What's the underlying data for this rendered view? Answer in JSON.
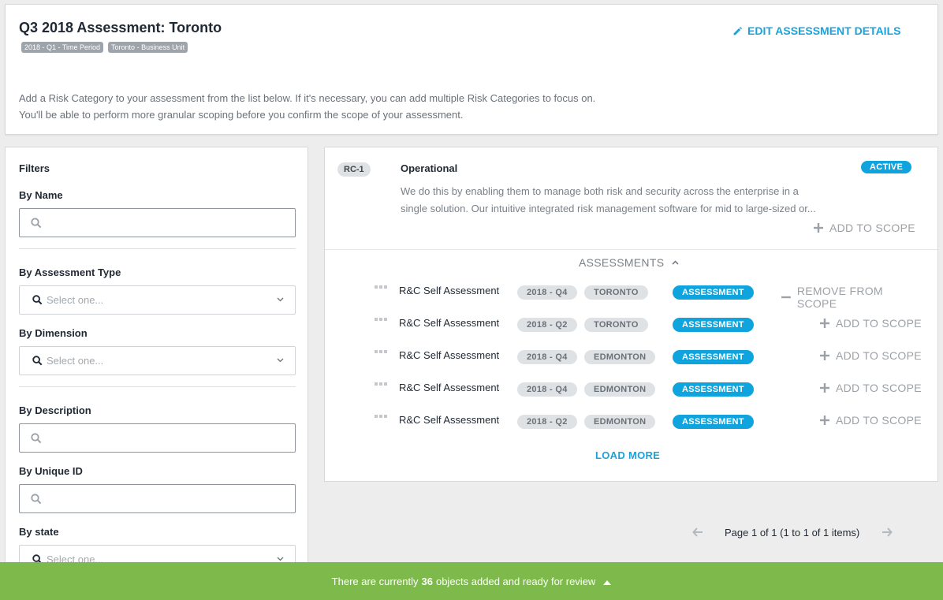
{
  "header": {
    "title": "Q3 2018 Assessment: Toronto",
    "tags": [
      "2018 - Q1 - Time Period",
      "Toronto - Business Unit"
    ],
    "edit_label": "EDIT ASSESSMENT DETAILS",
    "intro_line1": "Add a Risk Category to your assessment from the list below. If it's necessary, you can add multiple Risk Categories to focus on.",
    "intro_line2": "You'll be able to perform more granular scoping before you confirm the scope of your assessment."
  },
  "filters": {
    "title": "Filters",
    "by_name": "By Name",
    "by_assessment_type": "By Assessment Type",
    "by_dimension": "By Dimension",
    "by_description": "By Description",
    "by_unique_id": "By Unique ID",
    "by_state": "By state",
    "select_placeholder": "Select one..."
  },
  "category": {
    "id": "RC-1",
    "name": "Operational",
    "status": "ACTIVE",
    "description_line1": "We do this by enabling them to manage both risk and security across the enterprise in a",
    "description_line2": "single solution. Our intuitive integrated risk management software for mid to large-sized or...",
    "add_to_scope": "ADD TO SCOPE",
    "assessments_label": "ASSESSMENTS",
    "load_more": "LOAD MORE"
  },
  "assessments": [
    {
      "name": "R&C Self Assessment",
      "period": "2018 - Q4",
      "unit": "TORONTO",
      "type": "ASSESSMENT",
      "action": "REMOVE FROM SCOPE"
    },
    {
      "name": "R&C Self Assessment",
      "period": "2018 - Q2",
      "unit": "TORONTO",
      "type": "ASSESSMENT",
      "action": "ADD TO SCOPE"
    },
    {
      "name": "R&C Self Assessment",
      "period": "2018 - Q4",
      "unit": "EDMONTON",
      "type": "ASSESSMENT",
      "action": "ADD TO SCOPE"
    },
    {
      "name": "R&C Self Assessment",
      "period": "2018 - Q4",
      "unit": "EDMONTON",
      "type": "ASSESSMENT",
      "action": "ADD TO SCOPE"
    },
    {
      "name": "R&C Self Assessment",
      "period": "2018 - Q2",
      "unit": "EDMONTON",
      "type": "ASSESSMENT",
      "action": "ADD TO SCOPE"
    }
  ],
  "pagination": {
    "text": "Page 1 of 1 (1 to 1 of 1 items)"
  },
  "review_bar": {
    "prefix": "There are currently",
    "count": "36",
    "suffix": "objects added and ready for review"
  },
  "colors": {
    "accent": "#19a3dc",
    "badge_blue": "#0fa4dd",
    "review_green": "#7dba4b"
  }
}
